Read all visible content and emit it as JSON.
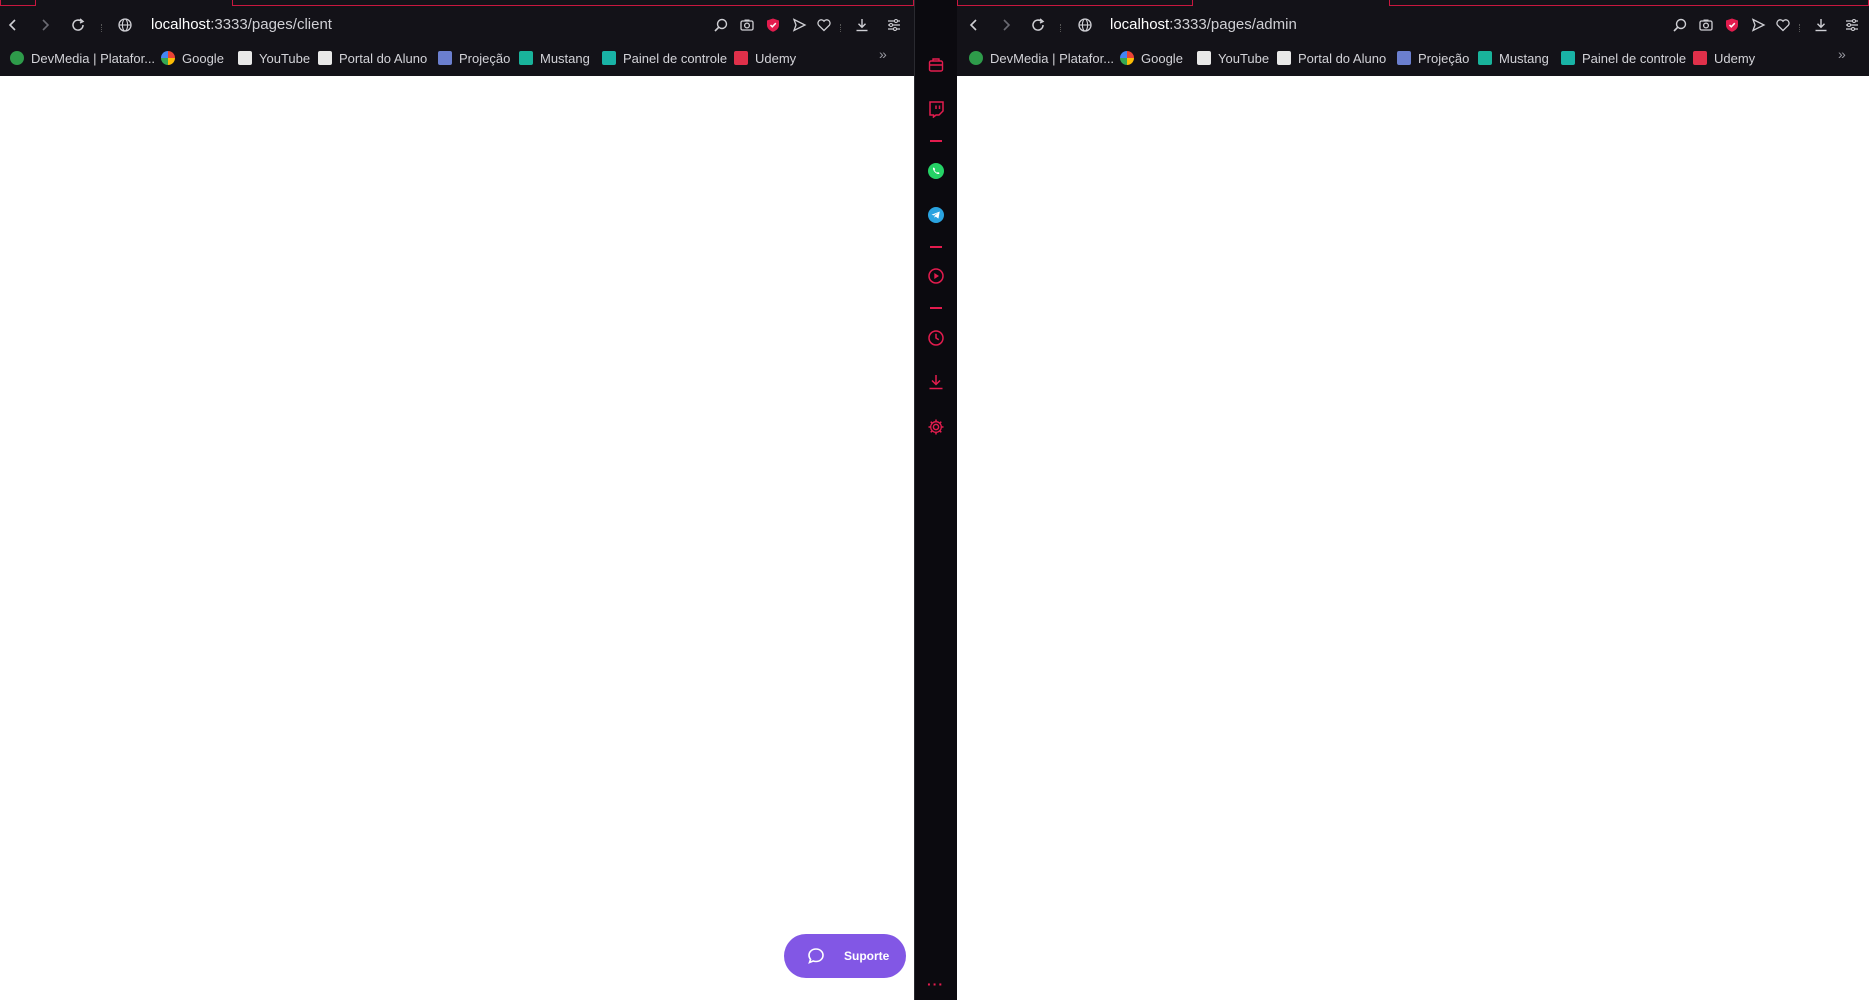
{
  "browser": {
    "accent_color": "#e31c4e",
    "bookmarks": [
      {
        "label": "DevMedia | Platafor...",
        "icon": "devmedia-icon",
        "color": "#2e9b4a"
      },
      {
        "label": "Google",
        "icon": "google-icon",
        "color": "#ffffff"
      },
      {
        "label": "YouTube",
        "icon": "page-icon",
        "color": "#e8e8e8"
      },
      {
        "label": "Portal do Aluno",
        "icon": "page-icon",
        "color": "#e8e8e8"
      },
      {
        "label": "Projeção",
        "icon": "projecao-icon",
        "color": "#6b7fcf"
      },
      {
        "label": "Mustang",
        "icon": "mustang-icon",
        "color": "#19b39b"
      },
      {
        "label": "Painel de controle",
        "icon": "info-icon",
        "color": "#19b3a6"
      },
      {
        "label": "Udemy",
        "icon": "udemy-icon",
        "color": "#e0304a"
      }
    ],
    "bookmarks_more": "»"
  },
  "left_window": {
    "url_host": "localhost",
    "url_rest": ":3333/pages/client",
    "support_button_label": "Suporte",
    "support_button_color": "#8257e5"
  },
  "right_window": {
    "url_host": "localhost",
    "url_rest": ":3333/pages/admin"
  },
  "sidebar": {
    "items": [
      "workspaces-icon",
      "twitch-icon",
      "whatsapp-icon",
      "telegram-icon",
      "player-icon",
      "history-icon",
      "downloads-icon",
      "settings-icon"
    ],
    "more_label": "···"
  }
}
